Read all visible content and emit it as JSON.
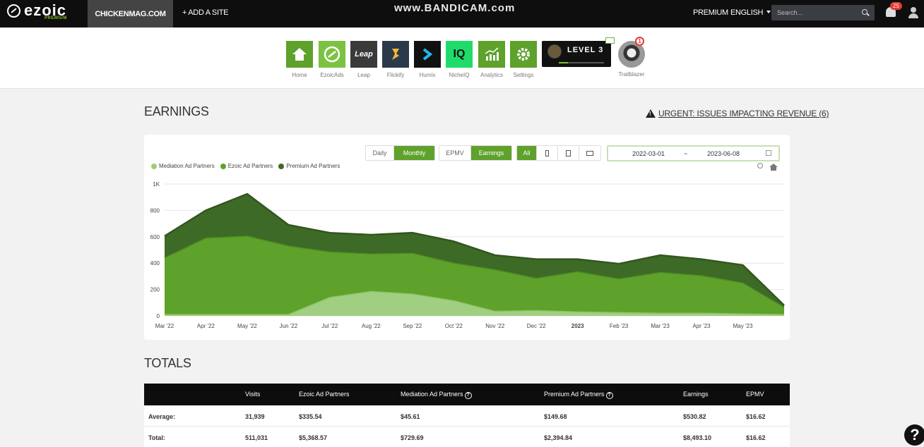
{
  "topbar": {
    "logo_text": "ezoic",
    "logo_sub": "PREMIUM",
    "site_name": "CHICKENMAG.COM",
    "add_site": "+ ADD A SITE",
    "watermark": "www.BANDICAM.com",
    "premium": "PREMIUM",
    "language": "ENGLISH",
    "search_placeholder": "Search...",
    "notification_count": "25"
  },
  "apps": [
    {
      "label": "Home",
      "icon": "home-icon",
      "color": "#5ea12b"
    },
    {
      "label": "EzoicAds",
      "icon": "ezoicads-icon",
      "color": "#7cc242"
    },
    {
      "label": "Leap",
      "icon": "leap-icon",
      "color": "#3a3a3a"
    },
    {
      "label": "Flickify",
      "icon": "flickify-icon",
      "color": "#2b3a4a"
    },
    {
      "label": "Humix",
      "icon": "humix-icon",
      "color": "#111111"
    },
    {
      "label": "NicheIQ",
      "icon": "nicheiq-icon",
      "color": "#1fdc6a"
    },
    {
      "label": "Analytics",
      "icon": "analytics-icon",
      "color": "#5ea12b"
    },
    {
      "label": "Settings",
      "icon": "settings-icon",
      "color": "#5ea12b"
    }
  ],
  "level": {
    "text": "LEVEL 3"
  },
  "trailblazer": {
    "label": "Trailblazer",
    "badge": "1"
  },
  "earnings": {
    "title": "EARNINGS",
    "urgent": "URGENT: ISSUES IMPACTING REVENUE (6)",
    "range_buttons": [
      "Daily",
      "Monthly"
    ],
    "metric_buttons": [
      "EPMV",
      "Earnings"
    ],
    "device_all": "All",
    "date_from": "2022-03-01",
    "date_sep": "~",
    "date_to": "2023-06-08"
  },
  "chart_data": {
    "type": "area",
    "stacked": true,
    "categories": [
      "Mar '22",
      "Apr '22",
      "May '22",
      "Jun '22",
      "Jul '22",
      "Aug '22",
      "Sep '22",
      "Oct '22",
      "Nov '22",
      "Dec '22",
      "2023",
      "Feb '23",
      "Mar '23",
      "Apr '23",
      "May '23",
      "Jun '23"
    ],
    "x_tick_labels": [
      "Mar '22",
      "Apr '22",
      "May '22",
      "Jun '22",
      "Jul '22",
      "Aug '22",
      "Sep '22",
      "Oct '22",
      "Nov '22",
      "Dec '22",
      "2023",
      "Feb '23",
      "Mar '23",
      "Apr '23",
      "May '23"
    ],
    "y_ticks": [
      "0",
      "200",
      "400",
      "600",
      "800",
      "1K"
    ],
    "ylim": [
      0,
      1000
    ],
    "grid": true,
    "legend_position": "top-left",
    "series": [
      {
        "name": "Mediation Ad Partners",
        "color": "#9ccc7a",
        "values": [
          10,
          10,
          10,
          10,
          140,
          185,
          165,
          115,
          35,
          40,
          30,
          25,
          20,
          20,
          15,
          10
        ]
      },
      {
        "name": "Ezoic Ad Partners",
        "color": "#5ea12b",
        "values": [
          430,
          580,
          595,
          520,
          345,
          285,
          310,
          285,
          315,
          245,
          305,
          255,
          310,
          285,
          235,
          55
        ]
      },
      {
        "name": "Premium Ad Partners",
        "color": "#3d6a26",
        "values": [
          165,
          210,
          320,
          160,
          145,
          145,
          155,
          165,
          110,
          145,
          95,
          115,
          130,
          125,
          135,
          15
        ]
      }
    ]
  },
  "totals": {
    "title": "TOTALS",
    "headers": [
      "Visits",
      "Ezoic Ad Partners",
      "Mediation Ad Partners",
      "Premium Ad Partners",
      "Earnings",
      "EPMV"
    ],
    "rows": [
      {
        "label": "Average:",
        "values": [
          "31,939",
          "$335.54",
          "$45.61",
          "$149.68",
          "$530.82",
          "$16.62"
        ]
      },
      {
        "label": "Total:",
        "values": [
          "511,031",
          "$5,368.57",
          "$729.69",
          "$2,394.84",
          "$8,493.10",
          "$16.62"
        ]
      }
    ]
  },
  "help": "?"
}
